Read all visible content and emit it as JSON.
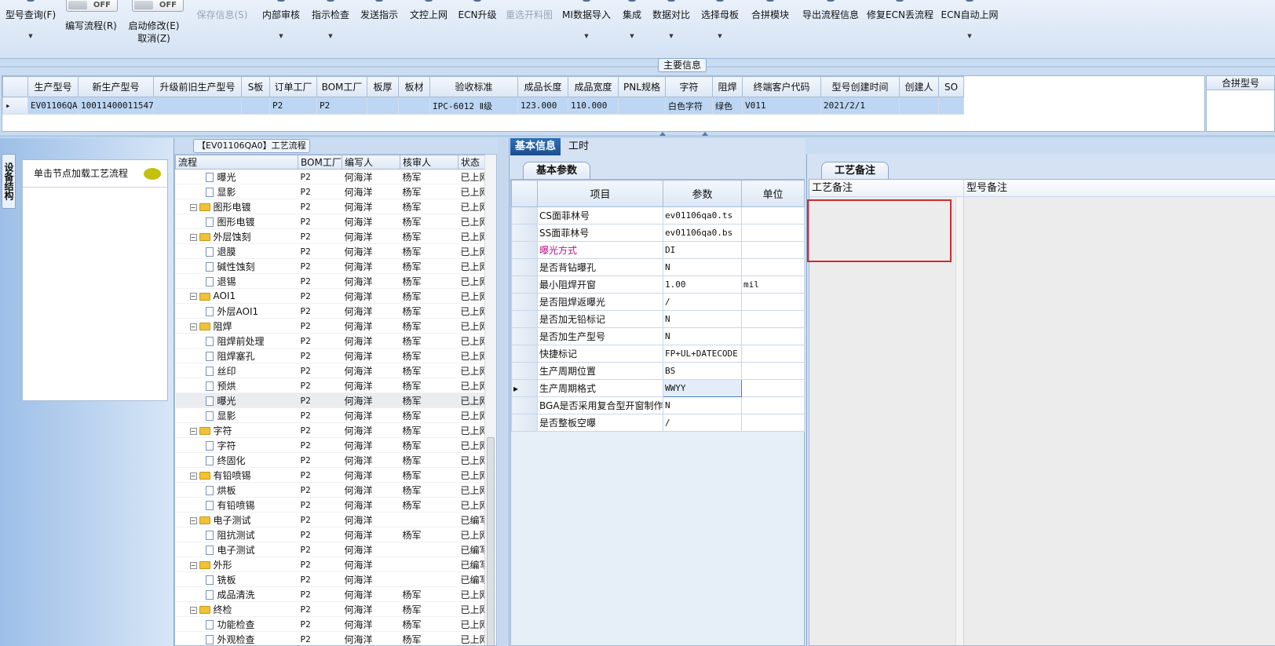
{
  "toolbar": {
    "model_query": "型号查询(F)",
    "toggle1": "OFF",
    "write_flow": "编写流程(R)",
    "toggle2": "OFF",
    "start_modify": "启动修改(E)",
    "cancel": "取消(Z)",
    "save_info": "保存信息(S)",
    "internal_review": "内部审核",
    "instruction_check": "指示检查",
    "send_instruction": "发送指示",
    "doc_upload": "文控上网",
    "ecn_upgrade": "ECN升级",
    "reselect_drawing": "重选开料图",
    "mi_import": "MI数据导入",
    "integrate": "集成",
    "data_compare": "数据对比",
    "select_mother": "选择母板",
    "merge_module": "合拼模块",
    "export_flow": "导出流程信息",
    "fix_ecn": "修复ECN丢流程",
    "ecn_auto_upload": "ECN自动上网"
  },
  "main_info": {
    "title": "主要信息",
    "columns": [
      "生产型号",
      "新生产型号",
      "升级前旧生产型号",
      "S板",
      "订单工厂",
      "BOM工厂",
      "板厚",
      "板材",
      "验收标准",
      "成品长度",
      "成品宽度",
      "PNL规格",
      "字符",
      "阻焊",
      "终端客户代码",
      "型号创建时间",
      "创建人",
      "SO"
    ],
    "row": [
      "EV01106QA0",
      "10011400011547",
      "",
      "",
      "P2",
      "P2",
      "",
      "",
      "IPC-6012 Ⅱ级",
      "123.000",
      "110.000",
      "",
      "白色字符",
      "绿色",
      "V011",
      "2021/2/1",
      "",
      ""
    ],
    "side_header": "合拼型号"
  },
  "left": {
    "vtab": "设备结构",
    "node_hint": "单击节点加载工艺流程"
  },
  "flow": {
    "title": "【EV01106QA0】工艺流程",
    "columns": [
      "流程",
      "BOM工厂",
      "编写人",
      "核审人",
      "状态"
    ],
    "rows": [
      {
        "name": "曝光",
        "lvl": 2,
        "bom": "P2",
        "writer": "何海洋",
        "reviewer": "杨军",
        "status": "已上网"
      },
      {
        "name": "显影",
        "lvl": 2,
        "bom": "P2",
        "writer": "何海洋",
        "reviewer": "杨军",
        "status": "已上网"
      },
      {
        "name": "图形电镀",
        "lvl": 1,
        "bom": "P2",
        "writer": "何海洋",
        "reviewer": "杨军",
        "status": "已上网"
      },
      {
        "name": "图形电镀",
        "lvl": 2,
        "bom": "P2",
        "writer": "何海洋",
        "reviewer": "杨军",
        "status": "已上网"
      },
      {
        "name": "外层蚀刻",
        "lvl": 1,
        "bom": "P2",
        "writer": "何海洋",
        "reviewer": "杨军",
        "status": "已上网"
      },
      {
        "name": "退膜",
        "lvl": 2,
        "bom": "P2",
        "writer": "何海洋",
        "reviewer": "杨军",
        "status": "已上网"
      },
      {
        "name": "碱性蚀刻",
        "lvl": 2,
        "bom": "P2",
        "writer": "何海洋",
        "reviewer": "杨军",
        "status": "已上网"
      },
      {
        "name": "退锡",
        "lvl": 2,
        "bom": "P2",
        "writer": "何海洋",
        "reviewer": "杨军",
        "status": "已上网"
      },
      {
        "name": "AOI1",
        "lvl": 1,
        "bom": "P2",
        "writer": "何海洋",
        "reviewer": "杨军",
        "status": "已上网"
      },
      {
        "name": "外层AOI1",
        "lvl": 2,
        "bom": "P2",
        "writer": "何海洋",
        "reviewer": "杨军",
        "status": "已上网"
      },
      {
        "name": "阻焊",
        "lvl": 1,
        "bom": "P2",
        "writer": "何海洋",
        "reviewer": "杨军",
        "status": "已上网"
      },
      {
        "name": "阻焊前处理",
        "lvl": 2,
        "bom": "P2",
        "writer": "何海洋",
        "reviewer": "杨军",
        "status": "已上网"
      },
      {
        "name": "阻焊塞孔",
        "lvl": 2,
        "bom": "P2",
        "writer": "何海洋",
        "reviewer": "杨军",
        "status": "已上网"
      },
      {
        "name": "丝印",
        "lvl": 2,
        "bom": "P2",
        "writer": "何海洋",
        "reviewer": "杨军",
        "status": "已上网"
      },
      {
        "name": "预烘",
        "lvl": 2,
        "bom": "P2",
        "writer": "何海洋",
        "reviewer": "杨军",
        "status": "已上网"
      },
      {
        "name": "曝光",
        "lvl": 2,
        "bom": "P2",
        "writer": "何海洋",
        "reviewer": "杨军",
        "status": "已上网",
        "sel": true
      },
      {
        "name": "显影",
        "lvl": 2,
        "bom": "P2",
        "writer": "何海洋",
        "reviewer": "杨军",
        "status": "已上网"
      },
      {
        "name": "字符",
        "lvl": 1,
        "bom": "P2",
        "writer": "何海洋",
        "reviewer": "杨军",
        "status": "已上网"
      },
      {
        "name": "字符",
        "lvl": 2,
        "bom": "P2",
        "writer": "何海洋",
        "reviewer": "杨军",
        "status": "已上网"
      },
      {
        "name": "终固化",
        "lvl": 2,
        "bom": "P2",
        "writer": "何海洋",
        "reviewer": "杨军",
        "status": "已上网"
      },
      {
        "name": "有铅喷锡",
        "lvl": 1,
        "bom": "P2",
        "writer": "何海洋",
        "reviewer": "杨军",
        "status": "已上网"
      },
      {
        "name": "烘板",
        "lvl": 2,
        "bom": "P2",
        "writer": "何海洋",
        "reviewer": "杨军",
        "status": "已上网"
      },
      {
        "name": "有铅喷锡",
        "lvl": 2,
        "bom": "P2",
        "writer": "何海洋",
        "reviewer": "杨军",
        "status": "已上网"
      },
      {
        "name": "电子测试",
        "lvl": 1,
        "bom": "P2",
        "writer": "何海洋",
        "reviewer": "",
        "status": "已编写"
      },
      {
        "name": "阻抗测试",
        "lvl": 2,
        "bom": "P2",
        "writer": "何海洋",
        "reviewer": "杨军",
        "status": "已上网"
      },
      {
        "name": "电子测试",
        "lvl": 2,
        "bom": "P2",
        "writer": "何海洋",
        "reviewer": "",
        "status": "已编写"
      },
      {
        "name": "外形",
        "lvl": 1,
        "bom": "P2",
        "writer": "何海洋",
        "reviewer": "",
        "status": "已编写"
      },
      {
        "name": "铣板",
        "lvl": 2,
        "bom": "P2",
        "writer": "何海洋",
        "reviewer": "",
        "status": "已编写"
      },
      {
        "name": "成品清洗",
        "lvl": 2,
        "bom": "P2",
        "writer": "何海洋",
        "reviewer": "杨军",
        "status": "已上网"
      },
      {
        "name": "终检",
        "lvl": 1,
        "bom": "P2",
        "writer": "何海洋",
        "reviewer": "杨军",
        "status": "已上网"
      },
      {
        "name": "功能检查",
        "lvl": 2,
        "bom": "P2",
        "writer": "何海洋",
        "reviewer": "杨军",
        "status": "已上网"
      },
      {
        "name": "外观检查",
        "lvl": 2,
        "bom": "P2",
        "writer": "何海洋",
        "reviewer": "杨军",
        "status": "已上网"
      }
    ]
  },
  "basic": {
    "tab_basic": "基本信息",
    "tab_hours": "工时",
    "subtab": "基本参数",
    "columns": [
      "项目",
      "参数",
      "单位"
    ],
    "rows": [
      {
        "item": "CS面菲林号",
        "param": "ev01106qa0.ts",
        "unit": ""
      },
      {
        "item": "SS面菲林号",
        "param": "ev01106qa0.bs",
        "unit": ""
      },
      {
        "item": "曝光方式",
        "param": "DI",
        "unit": "",
        "hl": true
      },
      {
        "item": "是否背钻曝孔",
        "param": "N",
        "unit": ""
      },
      {
        "item": "最小阻焊开窗",
        "param": "1.00",
        "unit": "mil"
      },
      {
        "item": "是否阻焊返曝光",
        "param": "/",
        "unit": ""
      },
      {
        "item": "是否加无铅标记",
        "param": "N",
        "unit": ""
      },
      {
        "item": "是否加生产型号",
        "param": "N",
        "unit": ""
      },
      {
        "item": "快捷标记",
        "param": "FP+UL+DATECODE",
        "unit": ""
      },
      {
        "item": "生产周期位置",
        "param": "BS",
        "unit": ""
      },
      {
        "item": "生产周期格式",
        "param": "WWYY",
        "unit": "",
        "sel": true
      },
      {
        "item": "BGA是否采用复合型开窗制作",
        "param": "N",
        "unit": ""
      },
      {
        "item": "是否整板空曝",
        "param": "/",
        "unit": ""
      }
    ]
  },
  "notes": {
    "subtab": "工艺备注",
    "process_note": "工艺备注",
    "model_note": "型号备注"
  }
}
